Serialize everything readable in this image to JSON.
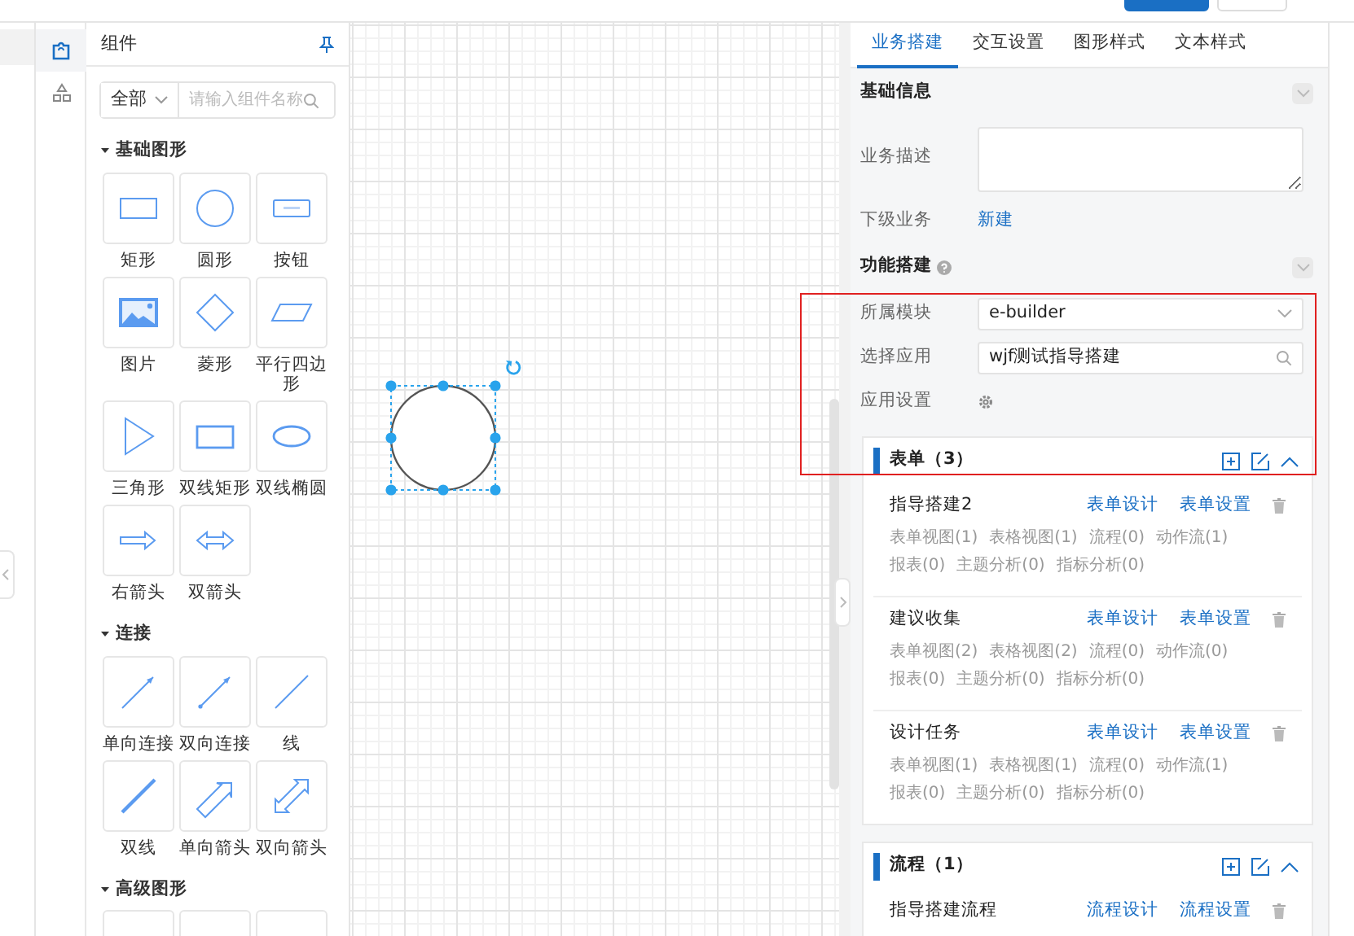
{
  "icon_rail": [
    {
      "kind": "components",
      "selected": true
    },
    {
      "kind": "shapes",
      "selected": false
    }
  ],
  "components_panel": {
    "title": "组件",
    "filter": {
      "value": "全部"
    },
    "search": {
      "placeholder": "请输入组件名称"
    },
    "groups": [
      {
        "title": "基础图形",
        "expanded": true,
        "items": [
          {
            "label": "矩形",
            "kind": "rect"
          },
          {
            "label": "圆形",
            "kind": "circle"
          },
          {
            "label": "按钮",
            "kind": "button"
          },
          {
            "label": "图片",
            "kind": "image"
          },
          {
            "label": "菱形",
            "kind": "diamond"
          },
          {
            "label": "平行四边形",
            "kind": "parallelogram"
          },
          {
            "label": "三角形",
            "kind": "triangle"
          },
          {
            "label": "双线矩形",
            "kind": "double-rect"
          },
          {
            "label": "双线椭圆",
            "kind": "ellipse"
          },
          {
            "label": "右箭头",
            "kind": "right-arrow"
          },
          {
            "label": "双箭头",
            "kind": "double-arrow"
          }
        ]
      },
      {
        "title": "连接",
        "expanded": true,
        "items": [
          {
            "label": "单向连接",
            "kind": "one-way"
          },
          {
            "label": "双向连接",
            "kind": "two-way"
          },
          {
            "label": "线",
            "kind": "line"
          },
          {
            "label": "双线",
            "kind": "double-line"
          },
          {
            "label": "单向箭头",
            "kind": "hollow-arrow"
          },
          {
            "label": "双向箭头",
            "kind": "hollow-double-arrow"
          }
        ]
      },
      {
        "title": "高级图形",
        "expanded": true,
        "items": [
          {
            "kind": "blank"
          },
          {
            "kind": "blank"
          },
          {
            "kind": "blank"
          }
        ]
      }
    ]
  },
  "canvas": {
    "shapes": [
      {
        "kind": "circle",
        "selected": true
      }
    ]
  },
  "properties_panel": {
    "tabs": [
      {
        "label": "业务搭建",
        "selected": true
      },
      {
        "label": "交互设置",
        "selected": false
      },
      {
        "label": "图形样式",
        "selected": false
      },
      {
        "label": "文本样式",
        "selected": false
      }
    ],
    "sections": [
      {
        "title": "基础信息",
        "help": false,
        "fields": [
          {
            "label": "业务描述",
            "kind": "textarea"
          },
          {
            "label": "下级业务",
            "kind": "link",
            "value": "新建"
          }
        ]
      },
      {
        "title": "功能搭建",
        "help": true,
        "fields": [
          {
            "label": "所属模块",
            "kind": "select",
            "value": "e-builder"
          },
          {
            "label": "选择应用",
            "kind": "search",
            "value": "wjf测试指导搭建"
          },
          {
            "label": "应用设置",
            "kind": "gear"
          }
        ]
      }
    ],
    "cards": [
      {
        "title": "表单（3）",
        "expanded": true,
        "items": [
          {
            "name": "指导搭建2",
            "actions": [
              "表单设计",
              "表单设置"
            ],
            "stats": [
              [
                "表单视图(1)",
                "表格视图(1)",
                "流程(0)",
                "动作流(1)"
              ],
              [
                "报表(0)",
                "主题分析(0)",
                "指标分析(0)"
              ]
            ]
          },
          {
            "name": "建议收集",
            "actions": [
              "表单设计",
              "表单设置"
            ],
            "stats": [
              [
                "表单视图(2)",
                "表格视图(2)",
                "流程(0)",
                "动作流(0)"
              ],
              [
                "报表(0)",
                "主题分析(0)",
                "指标分析(0)"
              ]
            ]
          },
          {
            "name": "设计任务",
            "actions": [
              "表单设计",
              "表单设置"
            ],
            "stats": [
              [
                "表单视图(1)",
                "表格视图(1)",
                "流程(0)",
                "动作流(1)"
              ],
              [
                "报表(0)",
                "主题分析(0)",
                "指标分析(0)"
              ]
            ]
          }
        ]
      },
      {
        "title": "流程（1）",
        "expanded": true,
        "items": [
          {
            "name": "指导搭建流程",
            "actions": [
              "流程设计",
              "流程设置"
            ]
          }
        ]
      }
    ]
  }
}
